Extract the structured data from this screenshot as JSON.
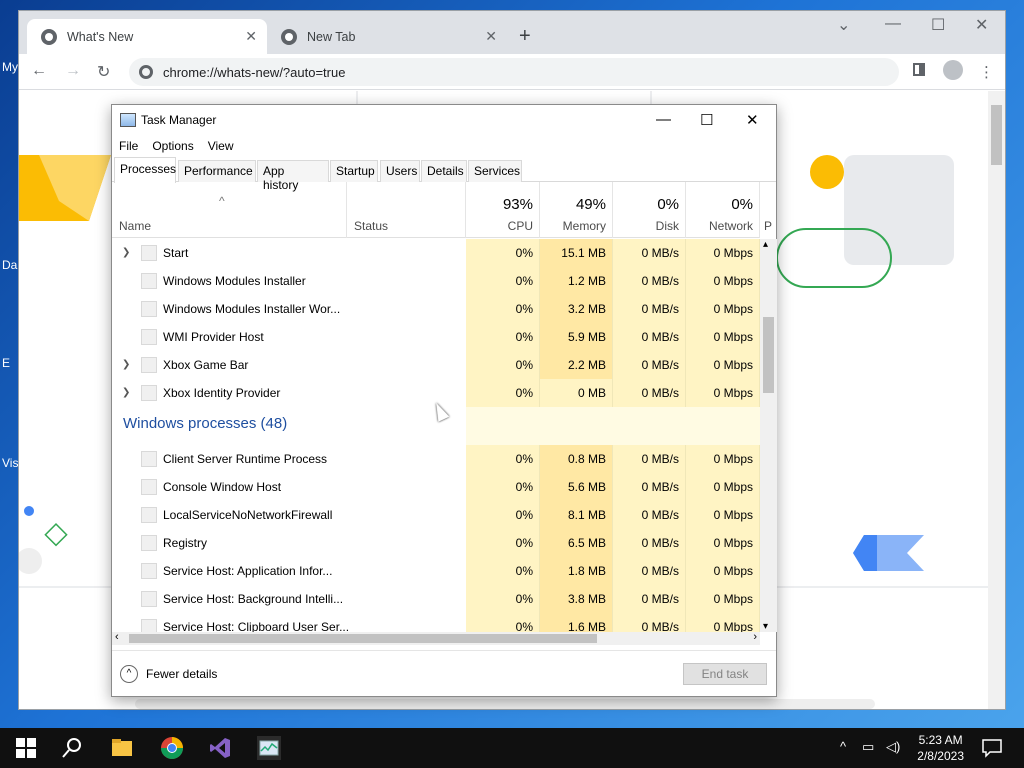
{
  "desktop": {
    "labels": [
      "My",
      "Da",
      "E",
      "Vis"
    ]
  },
  "chrome": {
    "tabs": [
      {
        "title": "What's New",
        "close": "✕"
      },
      {
        "title": "New Tab",
        "close": "✕"
      }
    ],
    "new_tab": "+",
    "window_controls": {
      "min": "—",
      "max": "☐",
      "close": "✕",
      "dropdown": "⌄"
    },
    "nav": {
      "back": "←",
      "forward": "→",
      "reload": "↻"
    },
    "address": "chrome://whats-new/?auto=true",
    "colors": {
      "tabstrip": "#dee1e6",
      "accent_yellow": "#fbbc04",
      "accent_green": "#34a853",
      "accent_blue": "#4285f4"
    }
  },
  "task_manager": {
    "title": "Task Manager",
    "window_controls": {
      "min": "—",
      "max": "☐",
      "close": "✕"
    },
    "menu": [
      "File",
      "Options",
      "View"
    ],
    "tabs": [
      "Processes",
      "Performance",
      "App history",
      "Startup",
      "Users",
      "Details",
      "Services"
    ],
    "columns": {
      "name": "Name",
      "status": "Status",
      "cpu": {
        "pct": "93%",
        "label": "CPU"
      },
      "memory": {
        "pct": "49%",
        "label": "Memory"
      },
      "disk": {
        "pct": "0%",
        "label": "Disk"
      },
      "network": {
        "pct": "0%",
        "label": "Network"
      },
      "power_partial": "P"
    },
    "apps": [
      {
        "name": "Start",
        "cpu": "0%",
        "memory": "15.1 MB",
        "disk": "0 MB/s",
        "network": "0 Mbps",
        "expandable": true
      },
      {
        "name": "Windows Modules Installer",
        "cpu": "0%",
        "memory": "1.2 MB",
        "disk": "0 MB/s",
        "network": "0 Mbps",
        "expandable": false
      },
      {
        "name": "Windows Modules Installer Wor...",
        "cpu": "0%",
        "memory": "3.2 MB",
        "disk": "0 MB/s",
        "network": "0 Mbps",
        "expandable": false
      },
      {
        "name": "WMI Provider Host",
        "cpu": "0%",
        "memory": "5.9 MB",
        "disk": "0 MB/s",
        "network": "0 Mbps",
        "expandable": false
      },
      {
        "name": "Xbox Game Bar",
        "cpu": "0%",
        "memory": "2.2 MB",
        "disk": "0 MB/s",
        "network": "0 Mbps",
        "expandable": true
      },
      {
        "name": "Xbox Identity Provider",
        "cpu": "0%",
        "memory": "0 MB",
        "disk": "0 MB/s",
        "network": "0 Mbps",
        "expandable": true
      }
    ],
    "group_title": "Windows processes (48)",
    "windows_processes": [
      {
        "name": "Client Server Runtime Process",
        "cpu": "0%",
        "memory": "0.8 MB",
        "disk": "0 MB/s",
        "network": "0 Mbps"
      },
      {
        "name": "Console Window Host",
        "cpu": "0%",
        "memory": "5.6 MB",
        "disk": "0 MB/s",
        "network": "0 Mbps"
      },
      {
        "name": "LocalServiceNoNetworkFirewall",
        "cpu": "0%",
        "memory": "8.1 MB",
        "disk": "0 MB/s",
        "network": "0 Mbps"
      },
      {
        "name": "Registry",
        "cpu": "0%",
        "memory": "6.5 MB",
        "disk": "0 MB/s",
        "network": "0 Mbps"
      },
      {
        "name": "Service Host: Application Infor...",
        "cpu": "0%",
        "memory": "1.8 MB",
        "disk": "0 MB/s",
        "network": "0 Mbps"
      },
      {
        "name": "Service Host: Background Intelli...",
        "cpu": "0%",
        "memory": "3.8 MB",
        "disk": "0 MB/s",
        "network": "0 Mbps"
      },
      {
        "name": "Service Host: Clipboard User Ser...",
        "cpu": "0%",
        "memory": "1.6 MB",
        "disk": "0 MB/s",
        "network": "0 Mbps"
      }
    ],
    "footer": {
      "fewer_details": "Fewer details",
      "end_task": "End task"
    }
  },
  "taskbar": {
    "time": "5:23 AM",
    "date": "2/8/2023",
    "icons": [
      "windows-start-icon",
      "search-icon",
      "file-explorer-icon",
      "chrome-icon",
      "visual-studio-icon",
      "task-manager-icon"
    ]
  }
}
